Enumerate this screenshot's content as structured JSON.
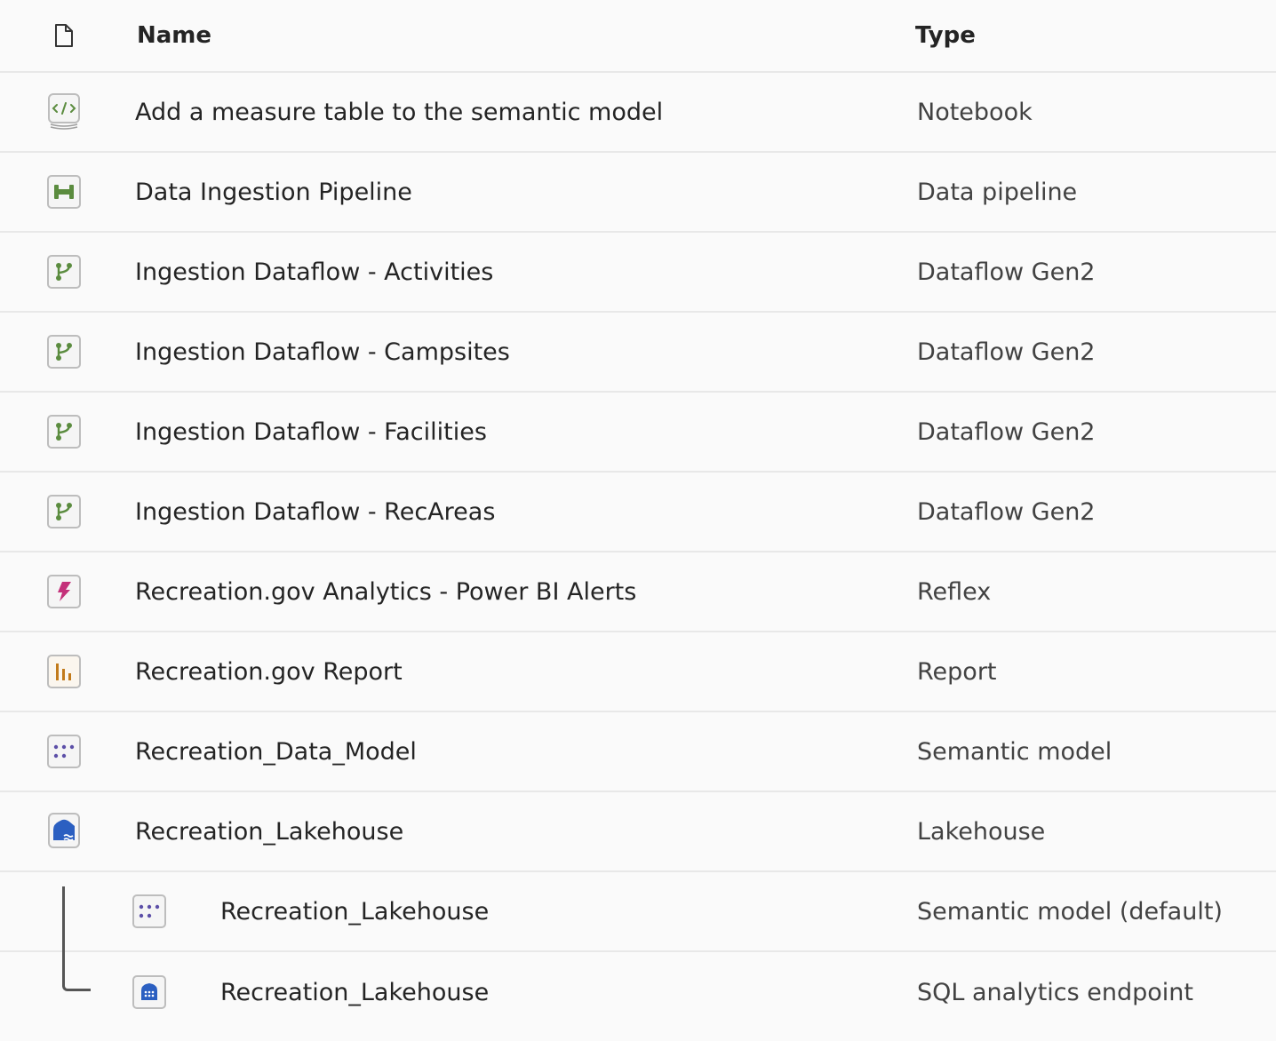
{
  "header": {
    "name_label": "Name",
    "type_label": "Type",
    "icon": "file-icon"
  },
  "rows": [
    {
      "name": "Add a measure table to the semantic model",
      "type": "Notebook",
      "icon": "notebook-icon"
    },
    {
      "name": "Data Ingestion Pipeline",
      "type": "Data pipeline",
      "icon": "pipeline-icon"
    },
    {
      "name": "Ingestion Dataflow - Activities",
      "type": "Dataflow Gen2",
      "icon": "dataflow-icon"
    },
    {
      "name": "Ingestion Dataflow - Campsites",
      "type": "Dataflow Gen2",
      "icon": "dataflow-icon"
    },
    {
      "name": "Ingestion Dataflow - Facilities",
      "type": "Dataflow Gen2",
      "icon": "dataflow-icon"
    },
    {
      "name": "Ingestion Dataflow - RecAreas",
      "type": "Dataflow Gen2",
      "icon": "dataflow-icon"
    },
    {
      "name": "Recreation.gov Analytics - Power BI Alerts",
      "type": "Reflex",
      "icon": "reflex-icon"
    },
    {
      "name": "Recreation.gov Report",
      "type": "Report",
      "icon": "report-icon"
    },
    {
      "name": "Recreation_Data_Model",
      "type": "Semantic model",
      "icon": "semantic-model-icon"
    },
    {
      "name": "Recreation_Lakehouse",
      "type": "Lakehouse",
      "icon": "lakehouse-icon"
    },
    {
      "name": "Recreation_Lakehouse",
      "type": "Semantic model (default)",
      "icon": "semantic-model-icon"
    },
    {
      "name": "Recreation_Lakehouse",
      "type": "SQL analytics endpoint",
      "icon": "sql-endpoint-icon"
    }
  ],
  "colors": {
    "green": "#5b8c3f",
    "pink": "#c4317a",
    "orange": "#c27a1a",
    "purple": "#5c4fa8",
    "blue": "#2b5fc1"
  }
}
